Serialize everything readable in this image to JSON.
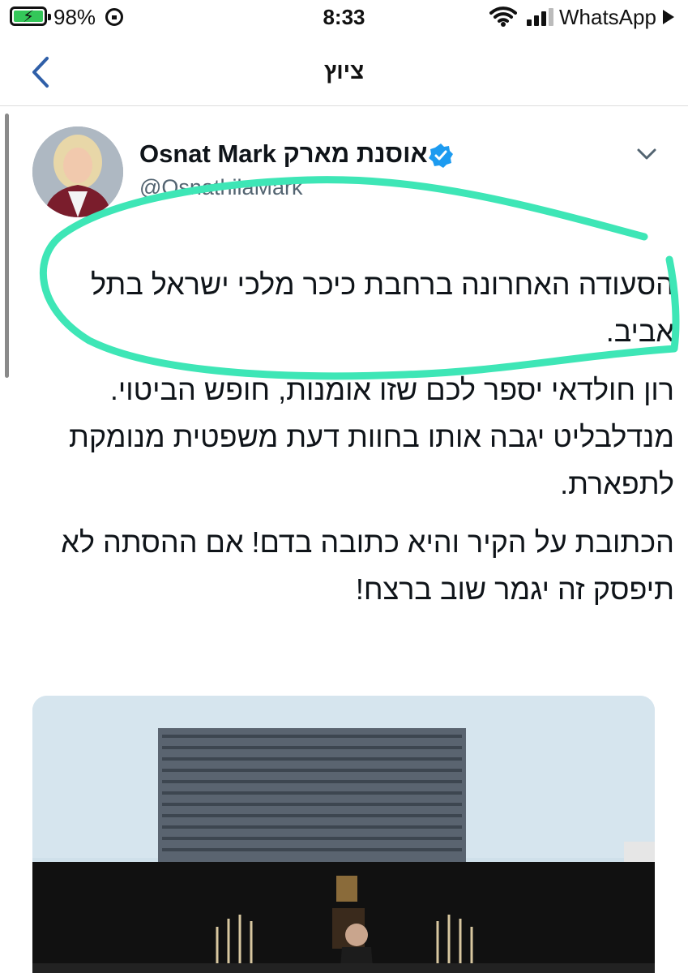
{
  "status_bar": {
    "battery": "98%",
    "time": "8:33",
    "back_app": "WhatsApp",
    "colors": {
      "battery_fill": "#34c759"
    }
  },
  "nav": {
    "title": "ציוץ",
    "back_icon": "chevron-left-icon"
  },
  "tweet": {
    "author_name": "Osnat Mark אוסנת מארק",
    "handle": "@OsnathilaMark",
    "verified_icon": "verified-badge-icon",
    "more_icon": "chevron-down-icon",
    "paragraphs": [
      "הסעודה האחרונה ברחבת כיכר מלכי ישראל בתל אביב.",
      "רון חולדאי יספר לכם שזו אומנות, חופש הביטוי. מנדלבליט יגבה אותו בחוות דעת משפטית מנומקת לתפארת.",
      "הכתובת על הקיר והיא כתובה בדם! אם ההסתה לא תיפסק זה יגמר שוב ברצח!"
    ],
    "highlight_color": "#3ee6b6"
  },
  "colors": {
    "accent": "#1d9bf0",
    "handle_gray": "#536471",
    "nav_chevron": "#2f5fa8"
  }
}
